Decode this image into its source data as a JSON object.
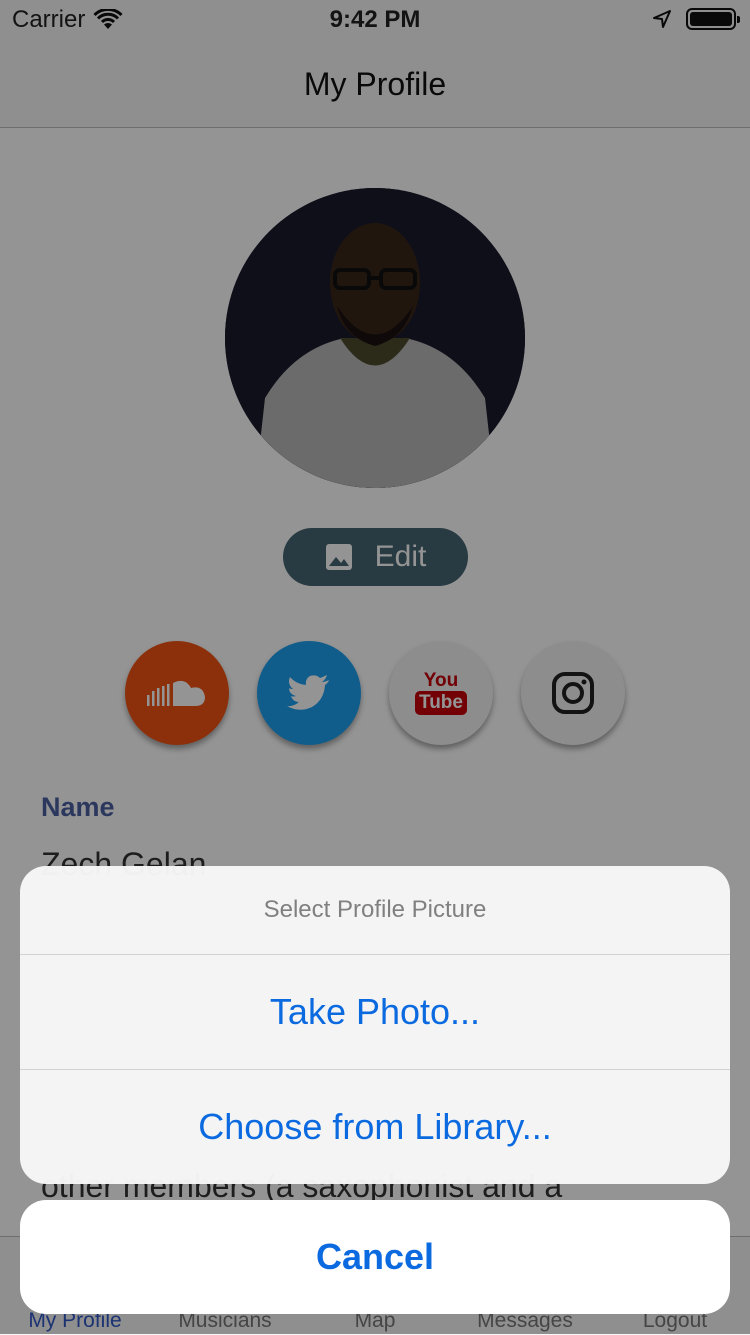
{
  "status_bar": {
    "carrier": "Carrier",
    "time": "9:42 PM"
  },
  "nav": {
    "title": "My Profile"
  },
  "profile": {
    "edit_label": "Edit",
    "social": [
      "soundcloud-icon",
      "twitter-icon",
      "youtube-icon",
      "instagram-icon"
    ],
    "youtube_you": "You",
    "youtube_tube": "Tube",
    "name_label": "Name",
    "name_value": "Zech Gelan",
    "bio_partial": "other members (a saxophonist and a"
  },
  "tabs": [
    {
      "label": "My Profile",
      "active": true
    },
    {
      "label": "Musicians"
    },
    {
      "label": "Map"
    },
    {
      "label": "Messages"
    },
    {
      "label": "Logout"
    }
  ],
  "action_sheet": {
    "title": "Select Profile Picture",
    "take_photo": "Take Photo...",
    "choose_library": "Choose from Library...",
    "cancel": "Cancel"
  },
  "colors": {
    "accent": "#0b6ae0",
    "edit_button": "#456472",
    "soundcloud": "#f15414",
    "twitter": "#1da1f2",
    "label": "#4a5fa0"
  }
}
